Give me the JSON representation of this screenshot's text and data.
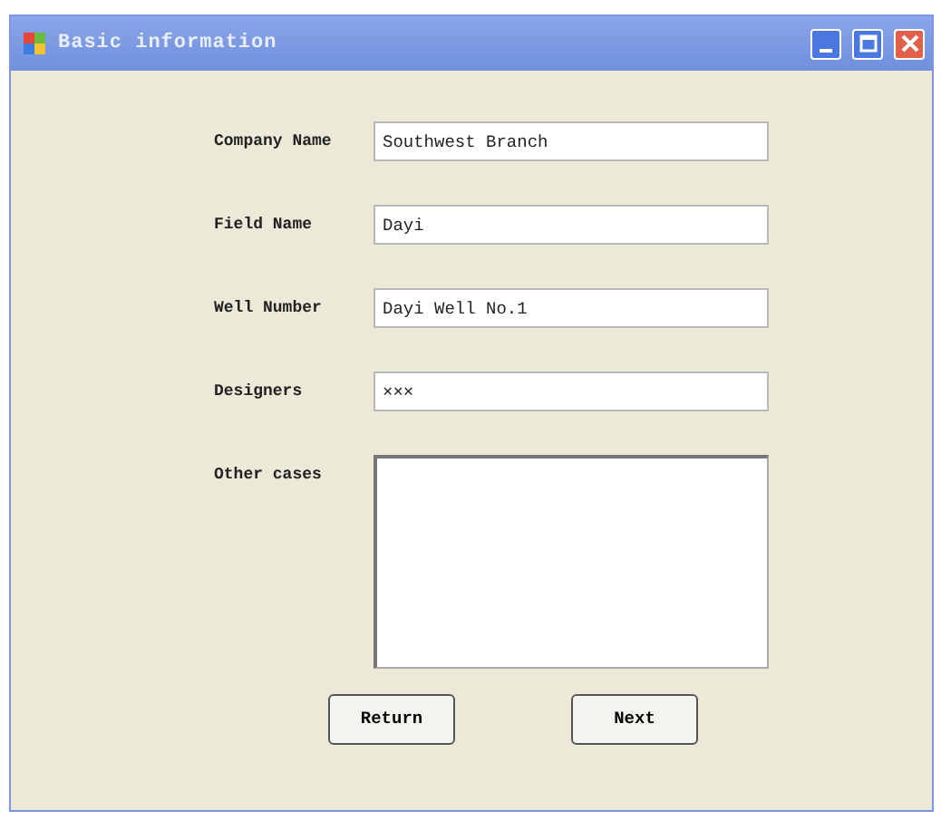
{
  "window": {
    "title": "Basic information"
  },
  "fields": [
    {
      "kind": "input",
      "label": "Company Name",
      "value": "Southwest Branch"
    },
    {
      "kind": "input",
      "label": "Field Name",
      "value": "Dayi"
    },
    {
      "kind": "input",
      "label": "Well Number",
      "value": "Dayi Well No.1"
    },
    {
      "kind": "input",
      "label": "Designers",
      "value": "×××"
    },
    {
      "kind": "textarea",
      "label": "Other cases"
    }
  ],
  "buttons": [
    "Return",
    "Next"
  ]
}
